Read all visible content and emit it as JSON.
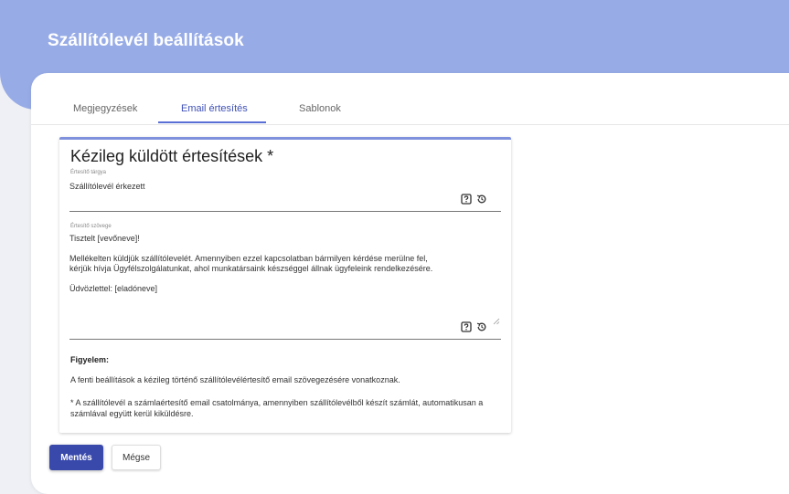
{
  "page": {
    "title": "Szállítólevél beállítások"
  },
  "tabs": [
    {
      "label": "Megjegyzések"
    },
    {
      "label": "Email értesítés"
    },
    {
      "label": "Sablonok"
    }
  ],
  "section": {
    "title": "Kézileg küldött értesítések *",
    "subject": {
      "label": "Értesítő tárgya",
      "value": "Szállítólevél érkezett"
    },
    "message": {
      "label": "Értesítő szövege",
      "lines": [
        "Tisztelt [vevőneve]!",
        "Mellékelten küldjük szállítólevelét. Amennyiben ezzel kapcsolatban bármilyen kérdése merülne fel,",
        "kérjük hívja Ügyfélszolgálatunkat, ahol munkatársaink készséggel állnak ügyfeleink rendelkezésére.",
        "Üdvözlettel: [eladóneve]"
      ]
    },
    "note": {
      "title": "Figyelem:",
      "line1": "A fenti beállítások a kézileg történő szállítólevélértesítő email szövegezésére vonatkoznak.",
      "line2": "* A szállítólevél a számlaértesítő email csatolmánya, amennyiben szállítólevélből készít számlát, automatikusan a számlával együtt kerül kiküldésre."
    }
  },
  "buttons": {
    "save": "Mentés",
    "cancel": "Mégse"
  },
  "icons": {
    "help": "help-box-icon",
    "reset": "restore-icon",
    "resize": "resize-handle-icon"
  },
  "colors": {
    "header": "#97abe6",
    "accent": "#3f51b5",
    "save_button": "#3949ab"
  }
}
